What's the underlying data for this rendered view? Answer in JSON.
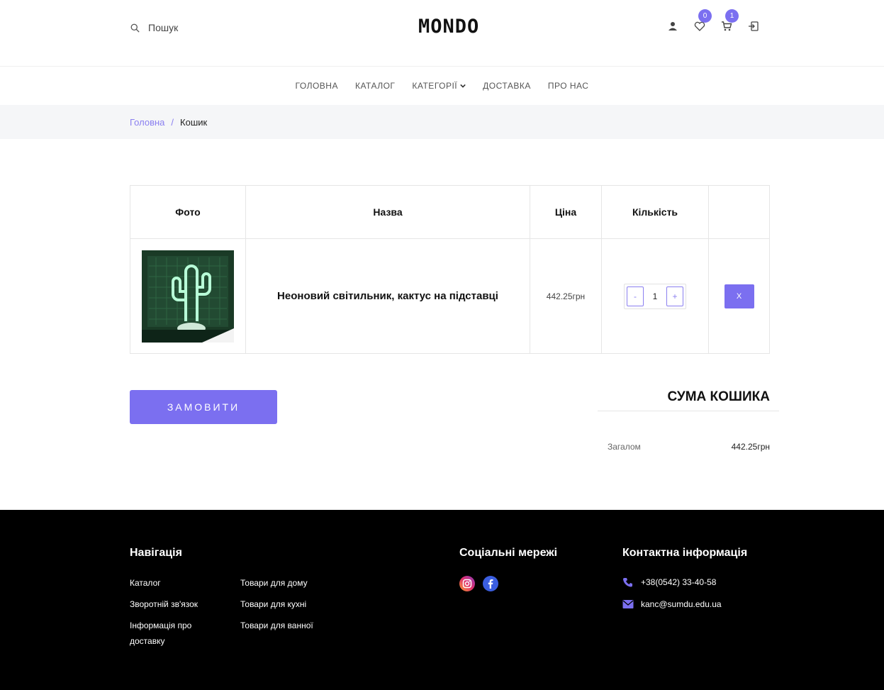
{
  "header": {
    "search_label": "Пошук",
    "logo": "MONDO",
    "wishlist_count": "0",
    "cart_count": "1"
  },
  "nav": {
    "items": [
      "ГОЛОВНА",
      "КАТАЛОГ",
      "КАТЕГОРІЇ",
      "ДОСТАВКА",
      "ПРО НАС"
    ]
  },
  "breadcrumb": {
    "home": "Головна",
    "separator": "/",
    "current": "Кошик"
  },
  "cart": {
    "columns": [
      "Фото",
      "Назва",
      "Ціна",
      "Кількість",
      ""
    ],
    "items": [
      {
        "name": "Неоновий світильник, кактус на підставці",
        "price": "442.25грн",
        "quantity": "1",
        "remove_label": "X"
      }
    ],
    "qty_minus": "-",
    "qty_plus": "+"
  },
  "order_button": "ЗАМОВИТИ",
  "summary": {
    "title": "СУМА КОШИКА",
    "total_label": "Загалом",
    "total_value": "442.25грн"
  },
  "footer": {
    "nav_title": "Навігація",
    "nav_col1": [
      "Каталог",
      "Зворотній зв'язок",
      "Інформація про доставку"
    ],
    "nav_col2": [
      "Товари для дому",
      "Товари для кухні",
      "Товари для ванної"
    ],
    "social_title": "Соціальні мережі",
    "contact_title": "Контактна інформація",
    "phone": "+38(0542) 33-40-58",
    "email": "kanc@sumdu.edu.ua"
  },
  "colors": {
    "accent": "#7b6ff0",
    "footer_bg": "#000000",
    "breadcrumb_bg": "#f5f6f8"
  }
}
